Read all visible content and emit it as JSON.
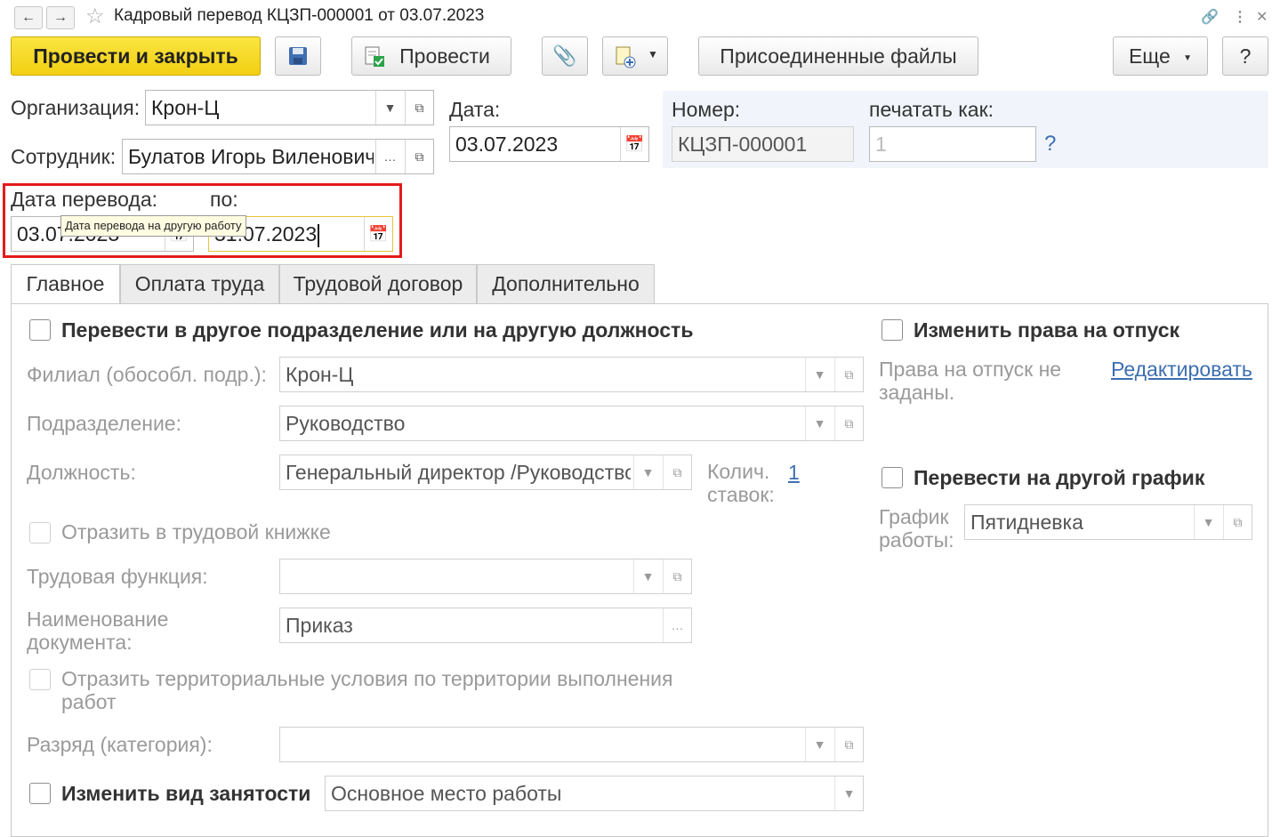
{
  "window": {
    "title": "Кадровый перевод КЦЗП-000001 от 03.07.2023",
    "back_icon": "arrow-left-icon",
    "forward_icon": "arrow-right-icon",
    "favorite_icon": "star-icon",
    "link_icon": "link-icon",
    "menu_icon": "more-vertical-icon",
    "close_icon": "close-icon"
  },
  "toolbar": {
    "post_and_close": "Провести и закрыть",
    "post": "Провести",
    "attached_files": "Присоединенные файлы",
    "more": "Еще",
    "help": "?"
  },
  "header": {
    "organization_label": "Организация:",
    "organization_value": "Крон-Ц",
    "employee_label": "Сотрудник:",
    "employee_value": "Булатов Игорь Виленович",
    "date_label": "Дата:",
    "date_value": "03.07.2023",
    "number_label": "Номер:",
    "number_value": "КЦЗП-000001",
    "print_as_label": "печатать как:",
    "print_as_value": "1",
    "help_mark": "?"
  },
  "transfer": {
    "date_label": "Дата перевода:",
    "to_label": "по:",
    "date_from_visible": "03.07.2023",
    "date_to_visible": "31.07.2023",
    "tooltip": "Дата перевода на другую работу"
  },
  "tabs": [
    {
      "label": "Главное",
      "active": true
    },
    {
      "label": "Оплата труда",
      "active": false
    },
    {
      "label": "Трудовой договор",
      "active": false
    },
    {
      "label": "Дополнительно",
      "active": false
    }
  ],
  "main": {
    "transfer_checkbox": "Перевести в другое подразделение или на другую должность",
    "branch_label": "Филиал (обособл. подр.):",
    "branch_value": "Крон-Ц",
    "department_label": "Подразделение:",
    "department_value": "Руководство",
    "position_label": "Должность:",
    "position_value": "Генеральный директор /Руководство",
    "rates_label_1": "Колич.",
    "rates_label_2": "ставок:",
    "rates_value": "1",
    "workbook_checkbox": "Отразить в трудовой книжке",
    "labor_function_label": "Трудовая функция:",
    "labor_function_value": "",
    "doc_name_label_1": "Наименование",
    "doc_name_label_2": "документа:",
    "doc_name_value": "Приказ",
    "territory_checkbox_1": "Отразить территориальные условия по территории выполнения",
    "territory_checkbox_2": "работ",
    "grade_label": "Разряд (категория):",
    "grade_value": "",
    "employment_checkbox": "Изменить вид занятости",
    "employment_value": "Основное место работы"
  },
  "right": {
    "vacation_checkbox": "Изменить права на отпуск",
    "vacation_text_1": "Права на отпуск не",
    "vacation_text_2": "заданы.",
    "edit_link": "Редактировать",
    "schedule_checkbox": "Перевести на другой график",
    "schedule_label_1": "График",
    "schedule_label_2": "работы:",
    "schedule_value": "Пятидневка"
  }
}
